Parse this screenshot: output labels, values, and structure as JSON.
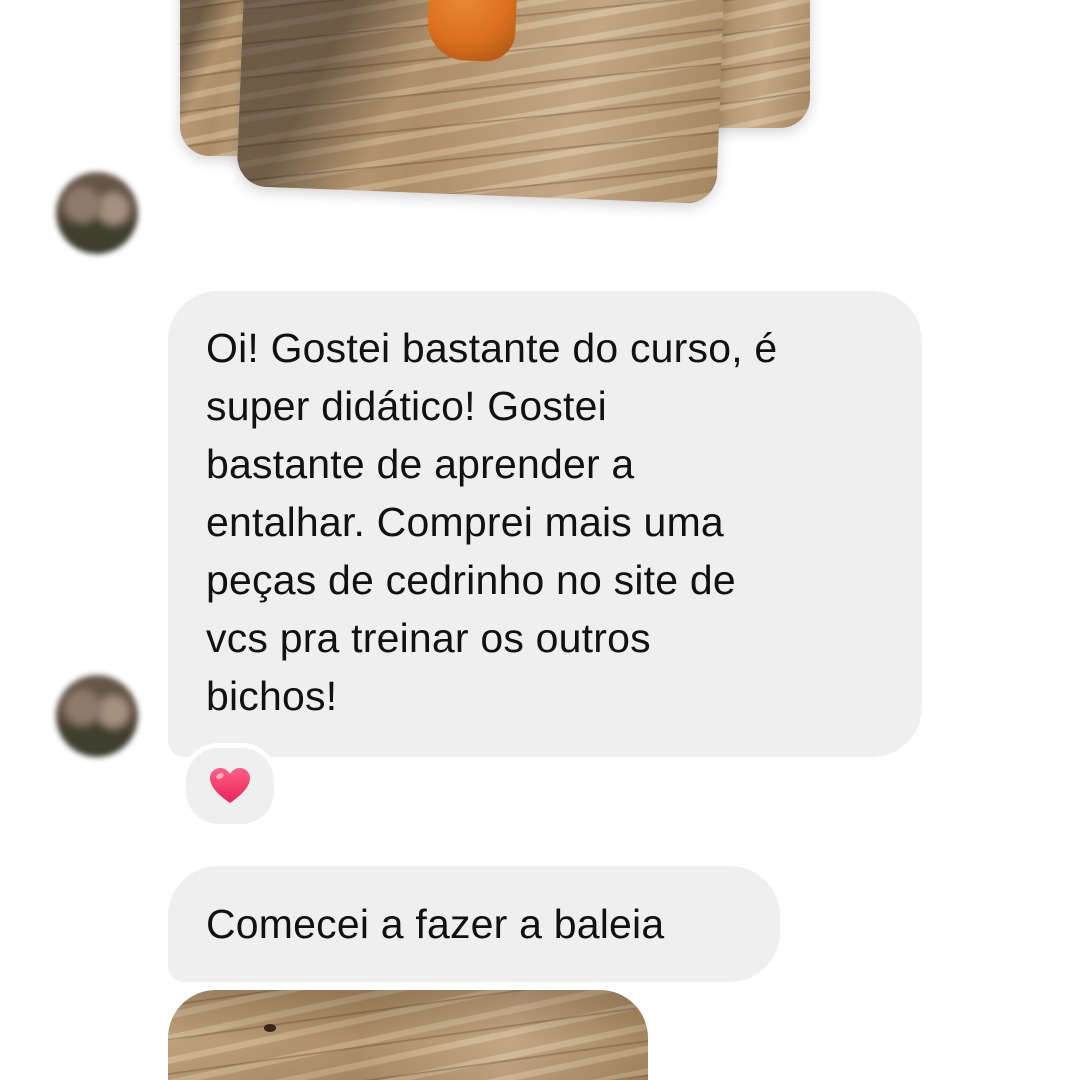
{
  "conversation": {
    "messages": [
      {
        "type": "image",
        "description_icon": "photo-stack-icon"
      },
      {
        "type": "text",
        "text": "Oi! Gostei bastante do curso, é\nsuper didático! Gostei\nbastante de aprender a\nentalhar. Comprei mais uma\npeças de cedrinho no site de\nvcs pra treinar os outros\nbichos!",
        "reaction": "heart-icon"
      },
      {
        "type": "text",
        "text": "Comecei a fazer a baleia"
      },
      {
        "type": "image",
        "description_icon": "photo-icon"
      }
    ]
  },
  "colors": {
    "bubble_background": "#efefef",
    "text": "#111111",
    "page_background": "#ffffff",
    "reaction_heart": "#f0396a"
  }
}
